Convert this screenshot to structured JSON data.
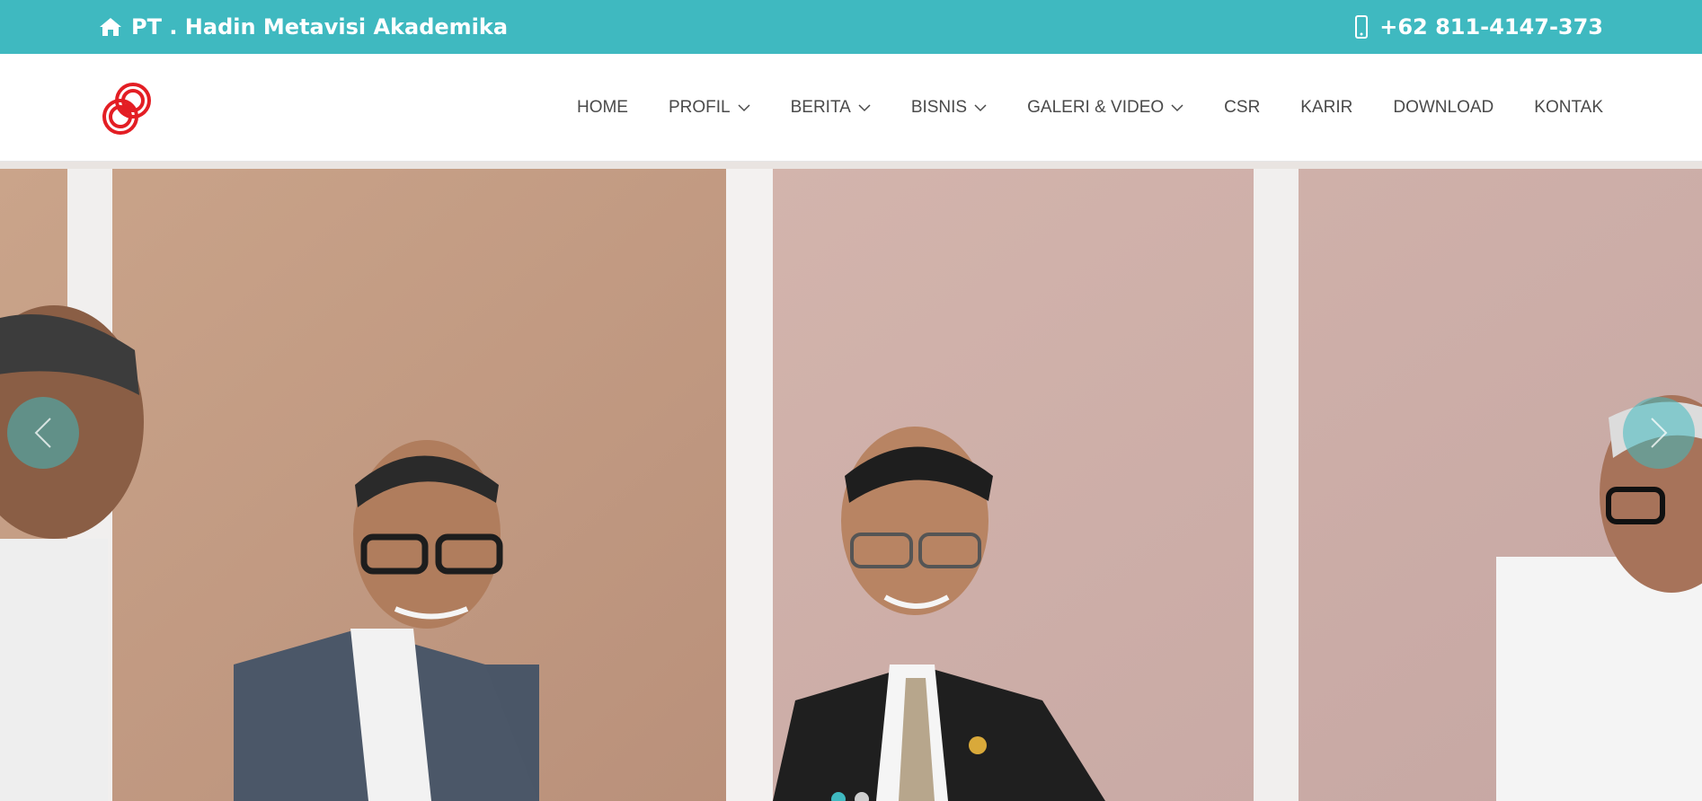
{
  "topbar": {
    "company_name": "PT . Hadin Metavisi Akademika",
    "phone": "+62 811-4147-373",
    "home_icon": "home-icon",
    "phone_icon": "mobile-phone-icon",
    "background_color": "#3fb9c0"
  },
  "nav": {
    "items": [
      {
        "label": "HOME",
        "dropdown": false
      },
      {
        "label": "PROFIL",
        "dropdown": true
      },
      {
        "label": "BERITA",
        "dropdown": true
      },
      {
        "label": "BISNIS",
        "dropdown": true
      },
      {
        "label": "GALERI & VIDEO",
        "dropdown": true
      },
      {
        "label": "CSR",
        "dropdown": false
      },
      {
        "label": "KARIR",
        "dropdown": false
      },
      {
        "label": "DOWNLOAD",
        "dropdown": false
      },
      {
        "label": "KONTAK",
        "dropdown": false
      }
    ]
  },
  "slider": {
    "prev_icon": "chevron-left-icon",
    "next_icon": "chevron-right-icon",
    "slide_count": 2,
    "active_slide": 1
  },
  "colors": {
    "accent": "#3fb9c0",
    "logo_red": "#e31e24",
    "nav_text": "#4a4a4a"
  }
}
